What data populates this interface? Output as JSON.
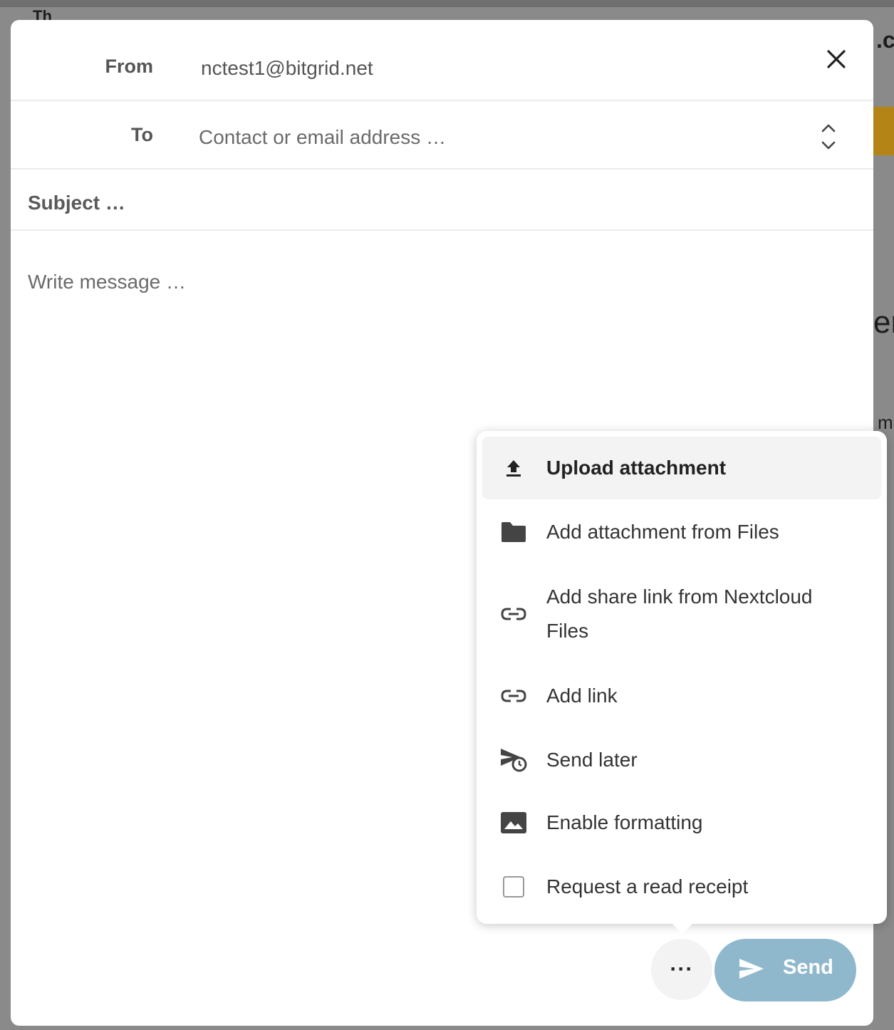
{
  "background": {
    "fragments": [
      ".c",
      "er",
      "m",
      "Th"
    ]
  },
  "composer": {
    "from_label": "From",
    "from_value": "nctest1@bitgrid.net",
    "to_label": "To",
    "to_placeholder": "Contact or email address …",
    "subject_placeholder": "Subject …",
    "body_placeholder": "Write message …"
  },
  "menu": {
    "items": [
      {
        "label": "Upload attachment",
        "icon": "upload-icon"
      },
      {
        "label": "Add attachment from Files",
        "icon": "folder-icon"
      },
      {
        "label": "Add share link from Nextcloud Files",
        "icon": "link-icon"
      },
      {
        "label": "Add link",
        "icon": "link-icon"
      },
      {
        "label": "Send later",
        "icon": "send-clock-icon"
      },
      {
        "label": "Enable formatting",
        "icon": "image-icon"
      },
      {
        "label": "Request a read receipt",
        "icon": "checkbox",
        "checked": false
      }
    ]
  },
  "actions": {
    "more_label": "···",
    "send_label": "Send"
  },
  "colors": {
    "send_button": "#8fb8cd",
    "menu_active_bg": "#f3f3f3"
  }
}
